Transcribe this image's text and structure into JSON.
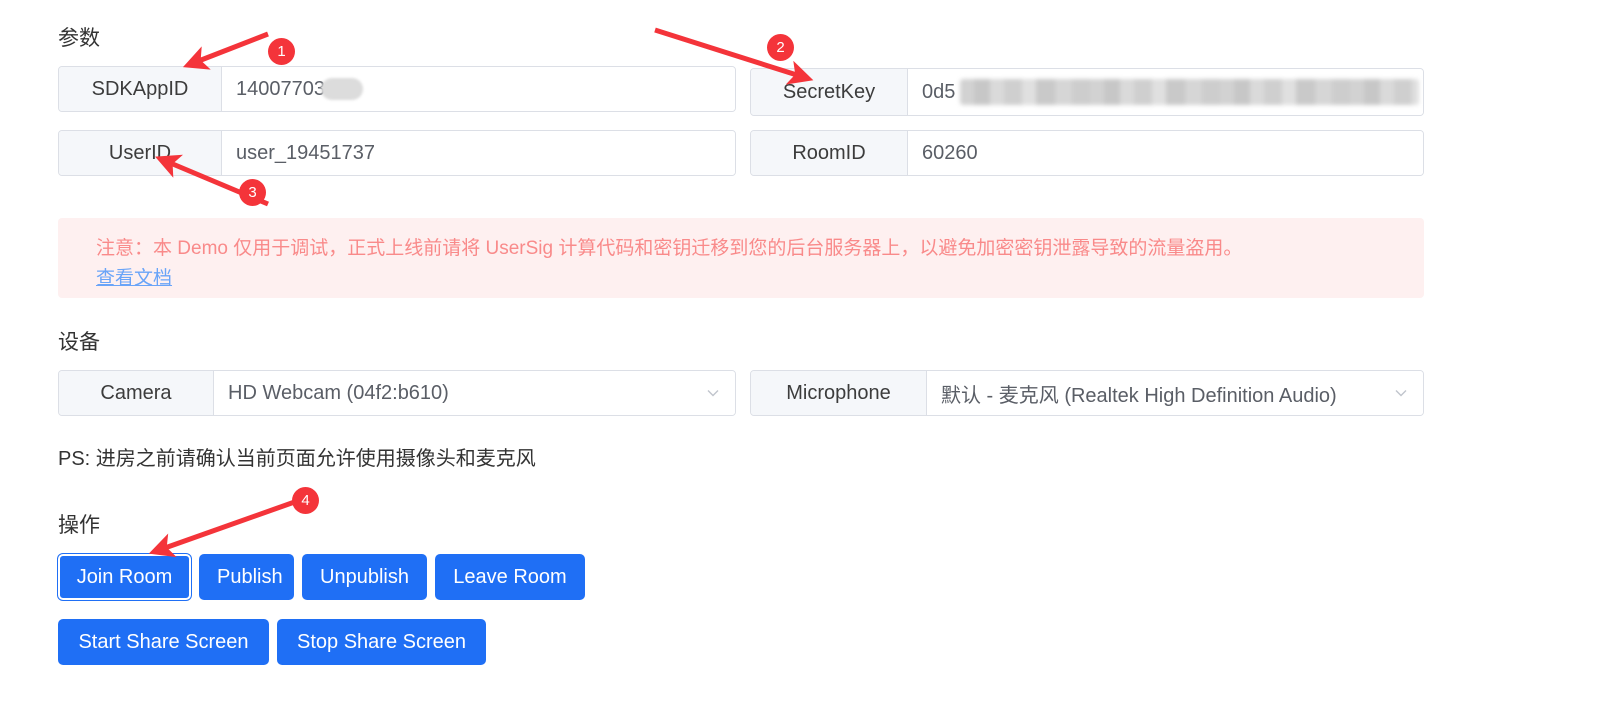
{
  "sections": {
    "params_title": "参数",
    "devices_title": "设备",
    "actions_title": "操作"
  },
  "params": {
    "sdkappid": {
      "label": "SDKAppID",
      "value": "14007703",
      "redacted": true
    },
    "secretkey": {
      "label": "SecretKey",
      "value": "0d5",
      "redacted": true
    },
    "userid": {
      "label": "UserID",
      "value": "user_19451737",
      "redacted": false
    },
    "roomid": {
      "label": "RoomID",
      "value": "60260",
      "redacted": false
    }
  },
  "alert": {
    "text": "注意：本 Demo 仅用于调试，正式上线前请将 UserSig 计算代码和密钥迁移到您的后台服务器上，以避免加密密钥泄露导致的流量盗用。",
    "link": "查看文档",
    "bg_color": "#fef0f0",
    "text_color": "#f98a8a",
    "link_color": "#6aa4f8"
  },
  "devices": {
    "camera": {
      "label": "Camera",
      "value": "HD Webcam (04f2:b610)",
      "icon": "chevron-down-icon"
    },
    "microphone": {
      "label": "Microphone",
      "value": "默认 - 麦克风 (Realtek High Definition Audio)",
      "icon": "chevron-down-icon"
    },
    "note": "PS: 进房之前请确认当前页面允许使用摄像头和麦克风"
  },
  "buttons": {
    "join_room": "Join Room",
    "publish": "Publish",
    "unpublish": "Unpublish",
    "leave_room": "Leave Room",
    "start_share_screen": "Start Share Screen",
    "stop_share_screen": "Stop Share Screen",
    "accent_color": "#1f6ff5"
  },
  "annotations": {
    "marker_color": "#f4343a",
    "markers": [
      {
        "number": "1",
        "target": "SDKAppID label"
      },
      {
        "number": "2",
        "target": "SecretKey label"
      },
      {
        "number": "3",
        "target": "UserID label"
      },
      {
        "number": "4",
        "target": "Join Room button"
      }
    ]
  }
}
